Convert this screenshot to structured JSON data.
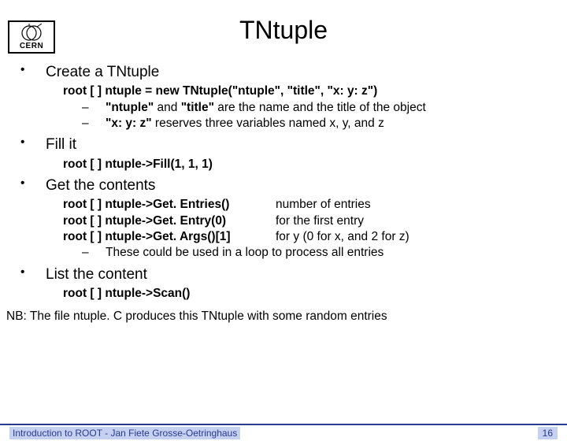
{
  "logo": {
    "text": "CERN"
  },
  "title": "TNtuple",
  "sections": [
    {
      "heading": "Create a TNtuple",
      "code": {
        "prefix": "root [ ] ",
        "body": "ntuple = new TNtuple(\"ntuple\", \"title\", \"x: y: z\")"
      },
      "sub": [
        {
          "bold": "\"ntuple\"",
          "mid": " and ",
          "bold2": "\"title\"",
          "rest": " are the name and the title of the object"
        },
        {
          "bold": "\"x: y: z\"",
          "rest": " reserves three variables named x, y, and z"
        }
      ]
    },
    {
      "heading": "Fill it",
      "code": {
        "prefix": "root [ ] ",
        "body": "ntuple->Fill(1, 1, 1)"
      }
    },
    {
      "heading": "Get the contents",
      "entries": [
        {
          "prefix": "root [ ] ",
          "cmd": "ntuple->Get. Entries()",
          "desc": "number of entries"
        },
        {
          "prefix": "root [ ] ",
          "cmd": "ntuple->Get. Entry(0)",
          "desc": "for the first entry"
        },
        {
          "prefix": "root [ ] ",
          "cmd": "ntuple->Get. Args()[1]",
          "desc": "for y (0 for x, and 2 for z)"
        }
      ],
      "sub": [
        {
          "rest": "These could be used in a loop to process all entries"
        }
      ]
    },
    {
      "heading": "List the content",
      "code": {
        "prefix": "root [ ] ",
        "body": "ntuple->Scan()"
      }
    }
  ],
  "note": "NB: The file ntuple. C produces this TNtuple with some random entries",
  "footer": {
    "left": "Introduction to ROOT - Jan Fiete Grosse-Oetringhaus",
    "page": "16"
  }
}
